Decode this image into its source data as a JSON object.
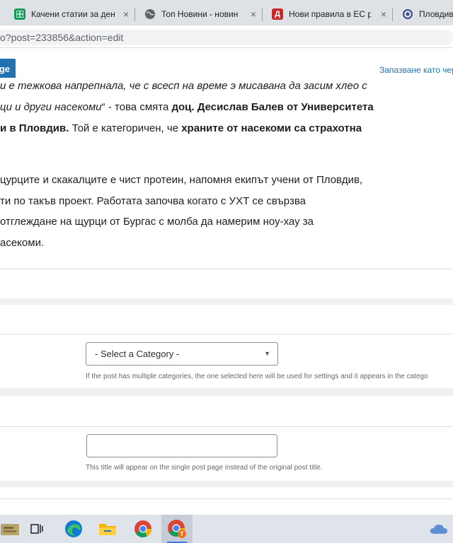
{
  "browser": {
    "tabs": [
      {
        "label": "Качени статии за ден",
        "icon": "sheets-icon"
      },
      {
        "label": "Топ Новини - новин",
        "icon": "globe-icon"
      },
      {
        "label": "Нови правила в ЕС р",
        "icon": "d-site-icon"
      },
      {
        "label": "Пловдивс",
        "icon": "site-icon"
      }
    ],
    "tab_close": "×",
    "url": "o?post=233856&action=edit"
  },
  "editor": {
    "primary_button": "ge",
    "save_draft": "Запазване като чер"
  },
  "content": {
    "line1": "и е тежкова напрепнала, че с всесп на време э мисавана да засим хлео с",
    "line2_a": "ци и други насекоми",
    "line2_b": "“ - това смята ",
    "line2_c": "доц. Десислав Балев от Университета",
    "line3_a": "и в Пловдив.",
    "line3_b": " Той е категоричен, че ",
    "line3_c": "храните от насекоми са страхотна",
    "line4": "цурците и скакалците е чист протеин, напомня екипът учени от Пловдив,",
    "line5": "ти по такъв проект. Работата започва когато с УХТ се свързва",
    "line6": "отглеждане на щурци от Бургас с молба да намерим ноу-хау за",
    "line7": "асекоми."
  },
  "category_panel": {
    "select_value": "- Select a Category -",
    "hint": "If the post has multiple categories, the one selected here will be used for settings and it appears in the catego"
  },
  "title_panel": {
    "input_value": "",
    "hint": "This title will appear on the single post page instead of the original post title."
  },
  "taskbar": {
    "items": [
      "task-view-icon",
      "edge-icon",
      "file-explorer-icon",
      "chrome-icon",
      "chrome-profile-icon",
      "onedrive-icon"
    ]
  },
  "colors": {
    "accent": "#2271b1",
    "text": "#1e1e1e",
    "hint": "#646970"
  }
}
